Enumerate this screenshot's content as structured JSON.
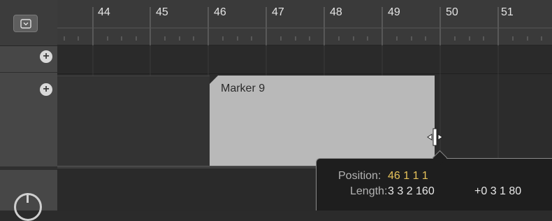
{
  "ruler": {
    "bars": [
      "44",
      "45",
      "46",
      "47",
      "48",
      "49",
      "50",
      "51"
    ]
  },
  "tracks": {
    "add_global_label": "+",
    "add_marker_label": "+"
  },
  "marker": {
    "name": "Marker 9"
  },
  "tooltip": {
    "position_label": "Position:",
    "position_value": "46 1 1 1",
    "length_label": "Length:",
    "length_value": "3 3 2 160",
    "delta_value": "+0 3 1 80",
    "position_color": "#e6c25a"
  }
}
